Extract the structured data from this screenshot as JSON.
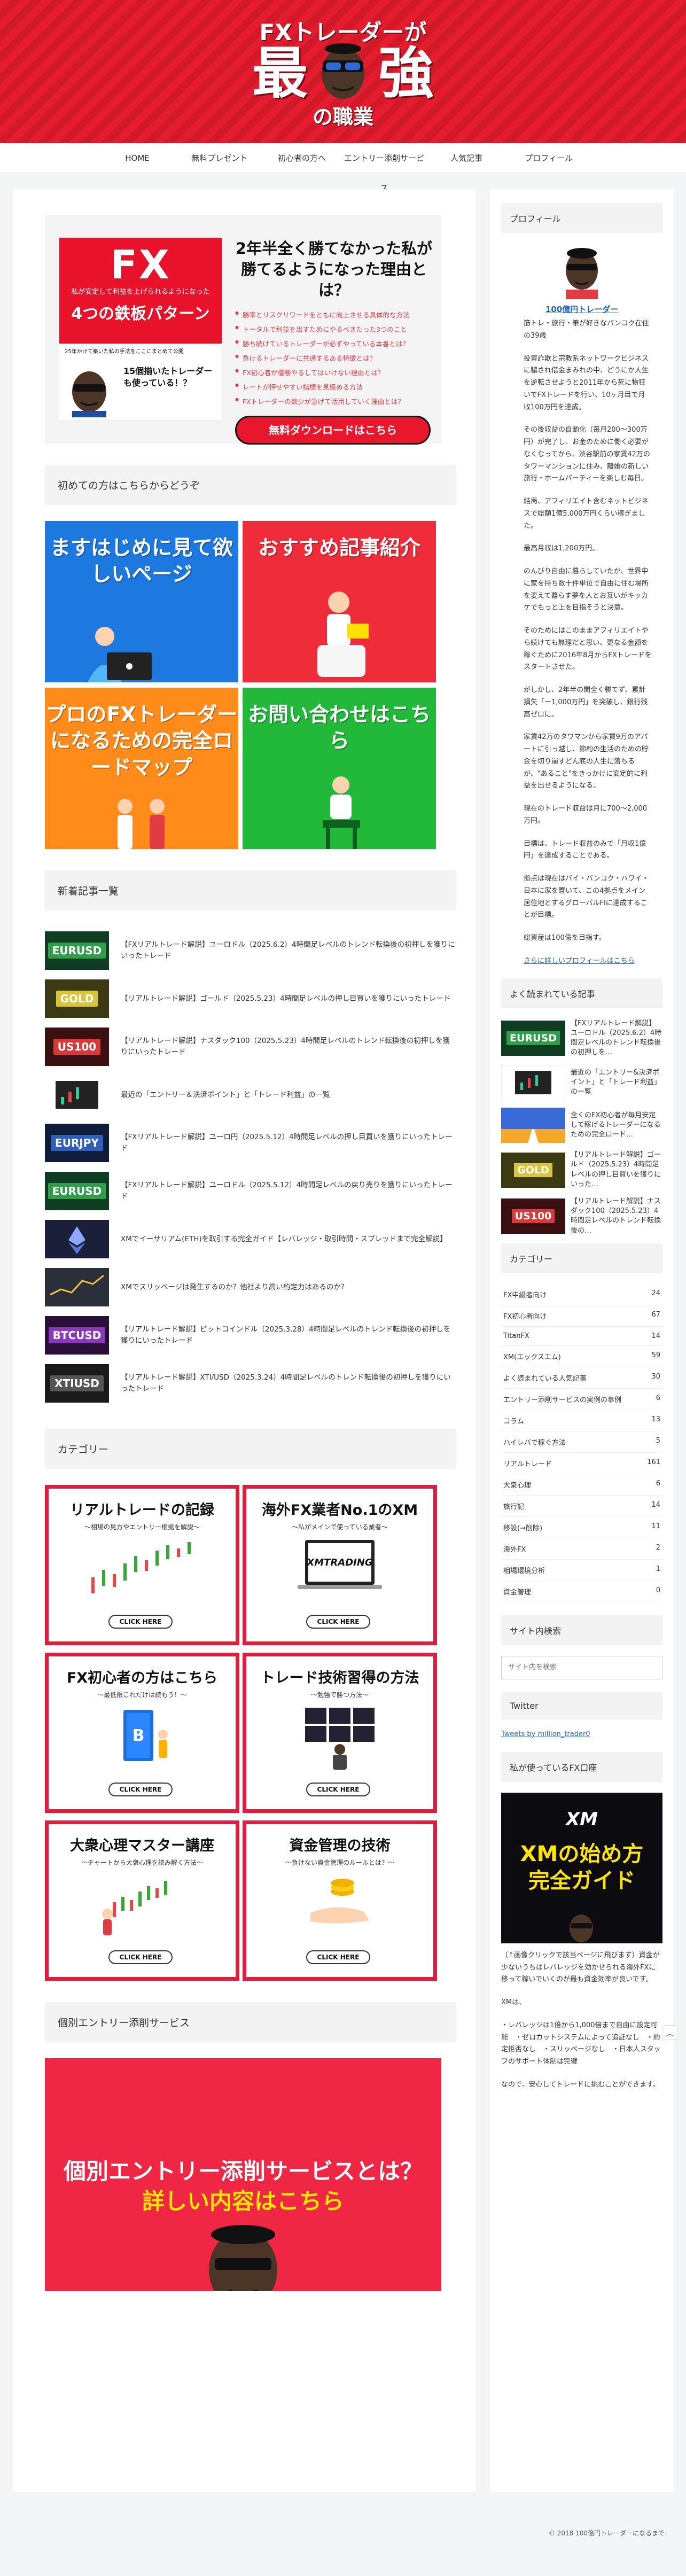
{
  "header": {
    "line1": "FXトレーダーが",
    "kanji1": "最",
    "kanji2": "強",
    "line3": "の職業"
  },
  "nav": [
    "HOME",
    "無料プレゼント",
    "初心者の方へ",
    "エントリー添削サービス",
    "人気記事",
    "プロフィール"
  ],
  "banner": {
    "fx": "FX",
    "fx_sub": "私が安定して利益を上げられるようになった",
    "fx_main": "4つの鉄板パターン",
    "small": "25年かけて築いた私の手法をここにまとめて公開",
    "book_title": "15個揃いたトレーダーも使っている！？",
    "headline": "2年半全く勝てなかった私が勝てるようになった理由とは？",
    "points": [
      "勝率とリスクリワードをともに向上させる具体的な方法",
      "トータルで利益を出すためにやるべきたった3つのこと",
      "勝ち続けているトレーダーが必ずやっている本番とは？",
      "負けるトレーダーに共通するある特徴とは？",
      "FX初心者が優勝やるしてはいけない理由とは？",
      "レートが押せやすい指標を見極める方法",
      "FXトレーダーの数少が急げて活用していく理由とは？"
    ],
    "cta": "無料ダウンロードはこちら"
  },
  "sections": {
    "beginners": "初めての方はこちらからどうぞ",
    "news": "新着記事一覧",
    "categories": "カテゴリー",
    "entry": "個別エントリー添削サービス"
  },
  "tiles": [
    {
      "text": "ますはじめに見て欲しいページ",
      "color": "#1d78e0"
    },
    {
      "text": "おすすめ記事紹介",
      "color": "#ef2d3a"
    },
    {
      "text": "プロのFXトレーダーになるための完全ロードマップ",
      "color": "#ff8c1a"
    },
    {
      "text": "お問い合わせはこちら",
      "color": "#22b83a"
    }
  ],
  "news": [
    {
      "thumb": "EURUSD",
      "color": "#2f9e4a",
      "title": "【FXリアルトレード解説】ユーロドル（2025.6.2）4時間足レベルのトレンド転換後の初押しを獲りにいったトレード"
    },
    {
      "thumb": "GOLD",
      "color": "#d8c53a",
      "title": "【リアルトレード解説】ゴールド（2025.5.23）4時間足レベルの押し目買いを獲りにいったトレード"
    },
    {
      "thumb": "US100",
      "color": "#d83a3a",
      "title": "【リアルトレード解説】ナスダック100（2025.5.23）4時間足レベルのトレンド転換後の初押しを獲りにいったトレード"
    },
    {
      "thumb": "",
      "color": "#2a2a2a",
      "title": "最近の「エントリー＆決済ポイント」と「トレード利益」の一覧"
    },
    {
      "thumb": "EURJPY",
      "color": "#2f5fb8",
      "title": "【FXリアルトレード解説】ユーロ円（2025.5.12）4時間足レベルの押し目買いを獲りにいったトレード"
    },
    {
      "thumb": "EURUSD",
      "color": "#2f9e4a",
      "title": "【FXリアルトレード解説】ユーロドル（2025.5.12）4時間足レベルの戻り売りを獲りにいったトレード"
    },
    {
      "thumb": "",
      "color": "#1b1f3a",
      "title": "XMでイーサリアム(ETH)を取引する完全ガイド【レバレッジ・取引時間・スプレッドまで完全解説】"
    },
    {
      "thumb": "",
      "color": "#2a2f3a",
      "title": "XMでスリッページは発生するのか？他社より高い約定力はあるのか？"
    },
    {
      "thumb": "BTCUSD",
      "color": "#8a3ab8",
      "title": "【リアルトレード解説】ビットコインドル（2025.3.28）4時間足レベルのトレンド転換後の初押しを獲りにいったトレード"
    },
    {
      "thumb": "XTIUSD",
      "color": "#2a2a2a",
      "title": "【リアルトレード解説】XTI/USD（2025.3.24）4時間足レベルのトレンド転換後の初押しを獲りにいったトレード"
    }
  ],
  "cat_tiles": [
    {
      "title": "リアルトレードの記録",
      "sub": "〜相場の見方やエントリー根拠を解説〜",
      "btn": "CLICK HERE"
    },
    {
      "title": "海外FX業者No.1のXM",
      "sub": "〜私がメインで使っている業者〜",
      "btn": "CLICK HERE"
    },
    {
      "title": "FX初心者の方はこちら",
      "sub": "〜最低限これだけは読もう！〜",
      "btn": "CLICK HERE"
    },
    {
      "title": "トレード技術習得の方法",
      "sub": "〜勉強で勝つ方法〜",
      "btn": "CLICK HERE"
    },
    {
      "title": "大衆心理マスター講座",
      "sub": "〜チャートから大衆心理を読み解く方法〜",
      "btn": "CLICK HERE"
    },
    {
      "title": "資金管理の技術",
      "sub": "〜負けない資金管理のルールとは？〜",
      "btn": "CLICK HERE"
    }
  ],
  "entry_banner": {
    "line1": "個別エントリー添削サービスとは？",
    "line2": "詳しい内容はこちら"
  },
  "sidebar": {
    "profile_h": "プロフィール",
    "name": "100億円トレーダー",
    "profile": [
      "筋トレ・旅行・筆が好きなバンコク在住の39歳",
      "投資詐欺と宗教系ネットワークビジネスに騙され借金まみれの中、どうにか人生を逆転させようと2011年から死に物狂いでFXトレードを行い、10ヶ月目で月収100万円を達成。",
      "その後収益の自動化（毎月200〜300万円）が完了し、お金のために働く必要がなくなってから、渋谷駅前の家賃42万のタワーマンションに住み、離婚の新しい旅行・ホームパーティーを楽しむ毎日。",
      "結局、アフィリエイト含むネットビジネスで総額1億5,000万円くらい稼ぎました。",
      "最高月収は1,200万円。",
      "のんびり自由に暮らしていたが、世界中に家を持ち数十件単位で自由に住む場所を変えて暮らす夢を人とお互いがキッカケでもっと上を目指そうと決意。",
      "そのためにはこのままアフィリエイトやら続けても無理だと思い、更なる金額を稼ぐために2016年8月からFXトレードをスタートさせた。",
      "がしかし、2年半の間全く勝てず、累計損失「ー1,000万円」を突破し、銀行残高ゼロに。",
      "家賃42万のタワマンから家賃9万のアパートに引っ越し、節約の生活のための貯金を切り崩すどん底の人生に落ちるが、\"あること\"をきっかけに安定的に利益を出せるようになる。",
      "現在のトレード収益は月に700〜2,000万円。",
      "目標は、トレード収益のみで「月収1億円」を達成することである。",
      "拠点は現在はバイ・バンコク・ハワイ・日本に家を置いて、この4拠点をメイン居住地とするグローバルFIに達成することが目標。",
      "総資産は100億を目指す。"
    ],
    "profile_link": "さらに詳しいプロフィールはこちら",
    "popular_h": "よく読まれている記事",
    "popular": [
      {
        "thumb": "EURUSD",
        "color": "#2f9e4a",
        "title": "【FXリアルトレード解説】ユーロドル（2025.6.2）4時間足レベルのトレンド転換後の初押しを…"
      },
      {
        "thumb": "",
        "color": "#2a2a2a",
        "title": "最近の「エントリー&決済ポイント」と「トレード利益」の一覧"
      },
      {
        "thumb": "",
        "color": "#3a6ad8",
        "title": "全くのFX初心者が毎月安定して稼げるトレーダーになるための完全ロード…"
      },
      {
        "thumb": "GOLD",
        "color": "#d8c53a",
        "title": "【リアルトレード解説】ゴールド（2025.5.23）4時間足レベルの押し目買いを獲りにいった…"
      },
      {
        "thumb": "US100",
        "color": "#d83a3a",
        "title": "【リアルトレード解説】ナスダック100（2025.5.23）4時間足レベルのトレンド転換後の…"
      }
    ],
    "cat_h": "カテゴリー",
    "categories": [
      {
        "name": "FX中級者向け",
        "count": "24"
      },
      {
        "name": "FX初心者向け",
        "count": "67"
      },
      {
        "name": "TitanFX",
        "count": "14"
      },
      {
        "name": "XM(エックスエム)",
        "count": "59"
      },
      {
        "name": "よく読まれている人気記事",
        "count": "30"
      },
      {
        "name": "エントリー添削サービスの実例の事例",
        "count": "6"
      },
      {
        "name": "コラム",
        "count": "13"
      },
      {
        "name": "ハイレバで稼ぐ方法",
        "count": "5"
      },
      {
        "name": "リアルトレード",
        "count": "161"
      },
      {
        "name": "大衆心理",
        "count": "6"
      },
      {
        "name": "旅行記",
        "count": "14"
      },
      {
        "name": "移設(→削除)",
        "count": "11"
      },
      {
        "name": "海外FX",
        "count": "2"
      },
      {
        "name": "相場環境分析",
        "count": "1"
      },
      {
        "name": "資金管理",
        "count": "0"
      }
    ],
    "search_h": "サイト内検索",
    "search_placeholder": "サイト内を検索",
    "twitter_h": "Twitter",
    "tweets": "Tweets by million_trader0",
    "xm_h": "私が使っているFX口座",
    "xm_ad": {
      "logo": "XM",
      "l1": "XMの始め方",
      "l2": "完全ガイド"
    },
    "xm_text": [
      "（↑画像クリックで該当ページに飛びます）資金が少ないうちはレバレッジを効かせられる海外FXに移って稼いでいくのが最も資金効率が良いです。",
      "XMは、",
      "・レバレッジは1倍から1,000倍まで自由に設定可能　・ゼロカットシステムによって追証なし　・約定拒否なし　・スリッページなし　・日本人スタッフのサポート体制は完璧",
      "なので、安心してトレードに挑むことができます。"
    ]
  },
  "footer": "© 2018 100億円トレーダーになるまで"
}
